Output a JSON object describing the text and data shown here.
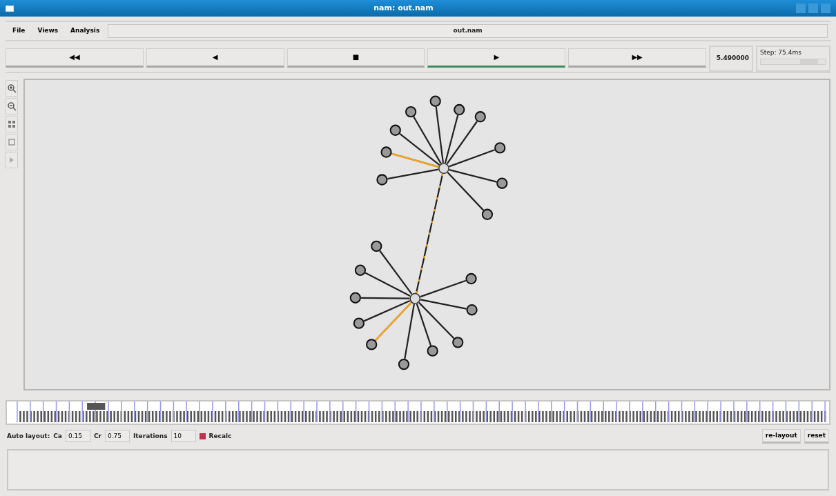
{
  "window": {
    "title": "nam: out.nam"
  },
  "menu": [
    {
      "label": "File"
    },
    {
      "label": "Views"
    },
    {
      "label": "Analysis"
    }
  ],
  "file_field": {
    "value": "out.nam"
  },
  "transport": [
    {
      "label": "◀◀",
      "selected": false
    },
    {
      "label": "◀",
      "selected": false
    },
    {
      "label": "■",
      "selected": false
    },
    {
      "label": "▶",
      "selected": true
    },
    {
      "label": "▶▶",
      "selected": false
    }
  ],
  "time": "5.490000",
  "step": {
    "label": "Step: 75.4ms",
    "level": 0.75
  },
  "network": {
    "backbone_active": true,
    "hubs": [
      {
        "leaves": [
          {
            "active": false
          },
          {
            "active": false
          },
          {
            "active": false
          },
          {
            "active": false
          },
          {
            "active": false
          },
          {
            "active": false
          },
          {
            "active": false
          },
          {
            "active": false
          },
          {
            "active": true
          },
          {
            "active": false
          }
        ]
      },
      {
        "leaves": [
          {
            "active": false
          },
          {
            "active": false
          },
          {
            "active": false
          },
          {
            "active": false
          },
          {
            "active": true
          },
          {
            "active": false
          },
          {
            "active": false
          },
          {
            "active": false
          },
          {
            "active": false
          },
          {
            "active": false
          }
        ]
      }
    ]
  },
  "auto_layout": {
    "label": "Auto layout:",
    "ca_label": "Ca",
    "ca": "0.15",
    "cr_label": "Cr",
    "cr": "0.75",
    "iter_label": "Iterations",
    "iterations": "10",
    "recalc": {
      "label": "Recalc",
      "checked": true
    }
  },
  "buttons": [
    {
      "label": "re-layout"
    },
    {
      "label": "reset"
    }
  ]
}
